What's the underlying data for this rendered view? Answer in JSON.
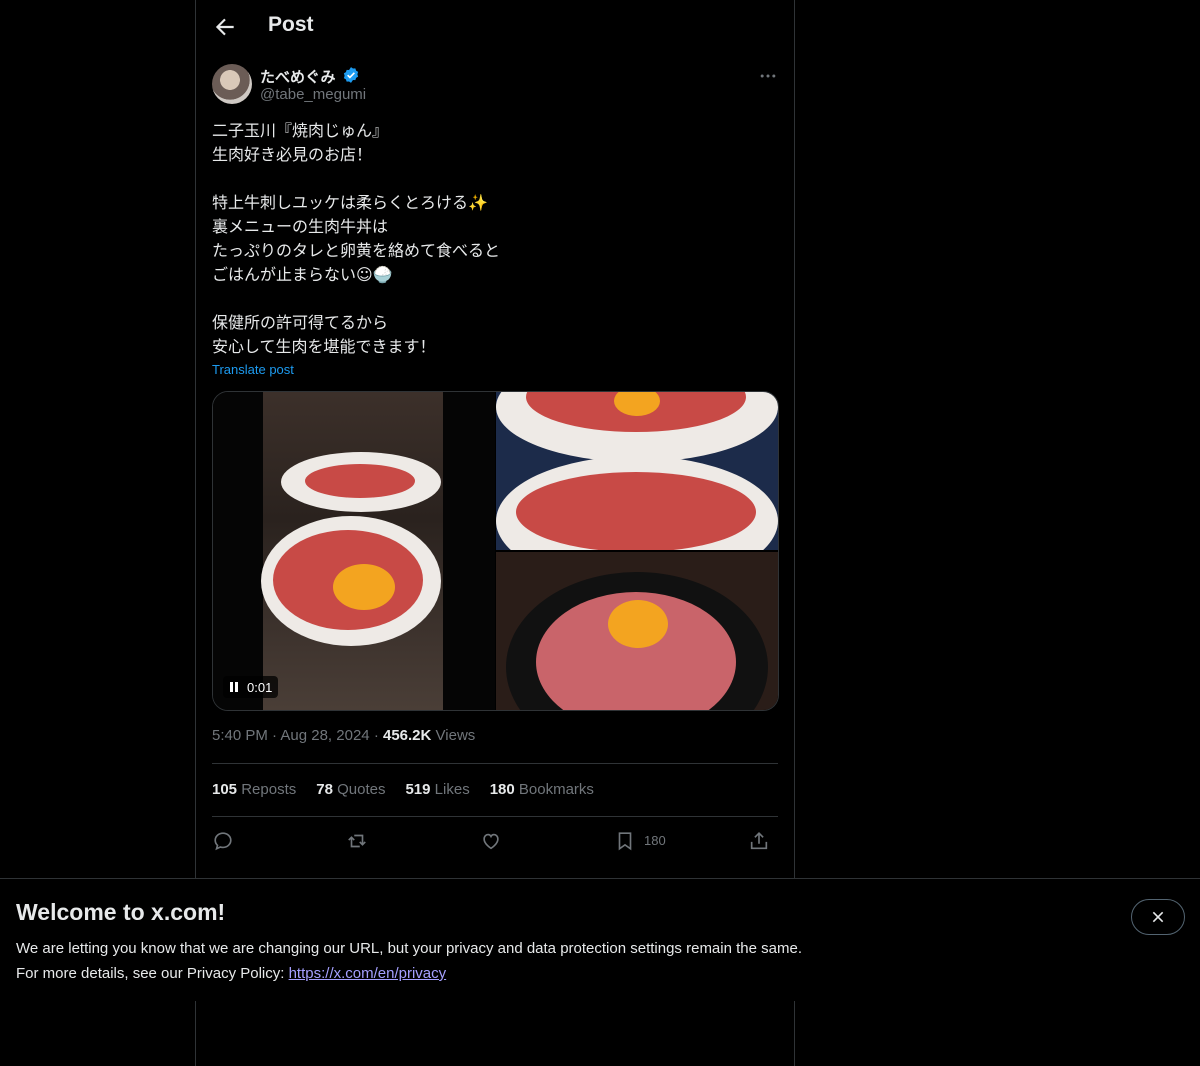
{
  "header": {
    "title": "Post",
    "back_icon": "back-arrow-icon"
  },
  "author": {
    "name": "たべめぐみ",
    "handle": "@tabe_megumi",
    "verified": true,
    "verified_color": "#1d9bf0"
  },
  "post": {
    "lines": [
      "二子玉川『焼肉じゅん』",
      "生肉好き必見のお店！",
      "",
      "特上牛刺しユッケは柔らくとろける✨",
      "裏メニューの生肉牛丼は",
      "たっぷりのタレと卵黄を絡めて食べると",
      "ごはんが止まらない☺🍚",
      "",
      "保健所の許可得てるから",
      "安心して生肉を堪能できます！"
    ],
    "translate_label": "Translate post",
    "video_duration": "0:01",
    "time": "5:40 PM",
    "date": "Aug 28, 2024",
    "views_count": "456.2K",
    "views_label": "Views"
  },
  "stats": {
    "reposts_count": "105",
    "reposts_label": "Reposts",
    "quotes_count": "78",
    "quotes_label": "Quotes",
    "likes_count": "519",
    "likes_label": "Likes",
    "bookmarks_count": "180",
    "bookmarks_label": "Bookmarks"
  },
  "actions": {
    "bookmark_count": "180"
  },
  "banner": {
    "title": "Welcome to x.com!",
    "line1": "We are letting you know that we are changing our URL, but your privacy and data protection settings remain the same.",
    "line2_prefix": "For more details, see our Privacy Policy: ",
    "link": "https://x.com/en/privacy"
  },
  "colors": {
    "accent": "#1d9bf0",
    "link": "#a5a0ff",
    "background": "#000000"
  }
}
